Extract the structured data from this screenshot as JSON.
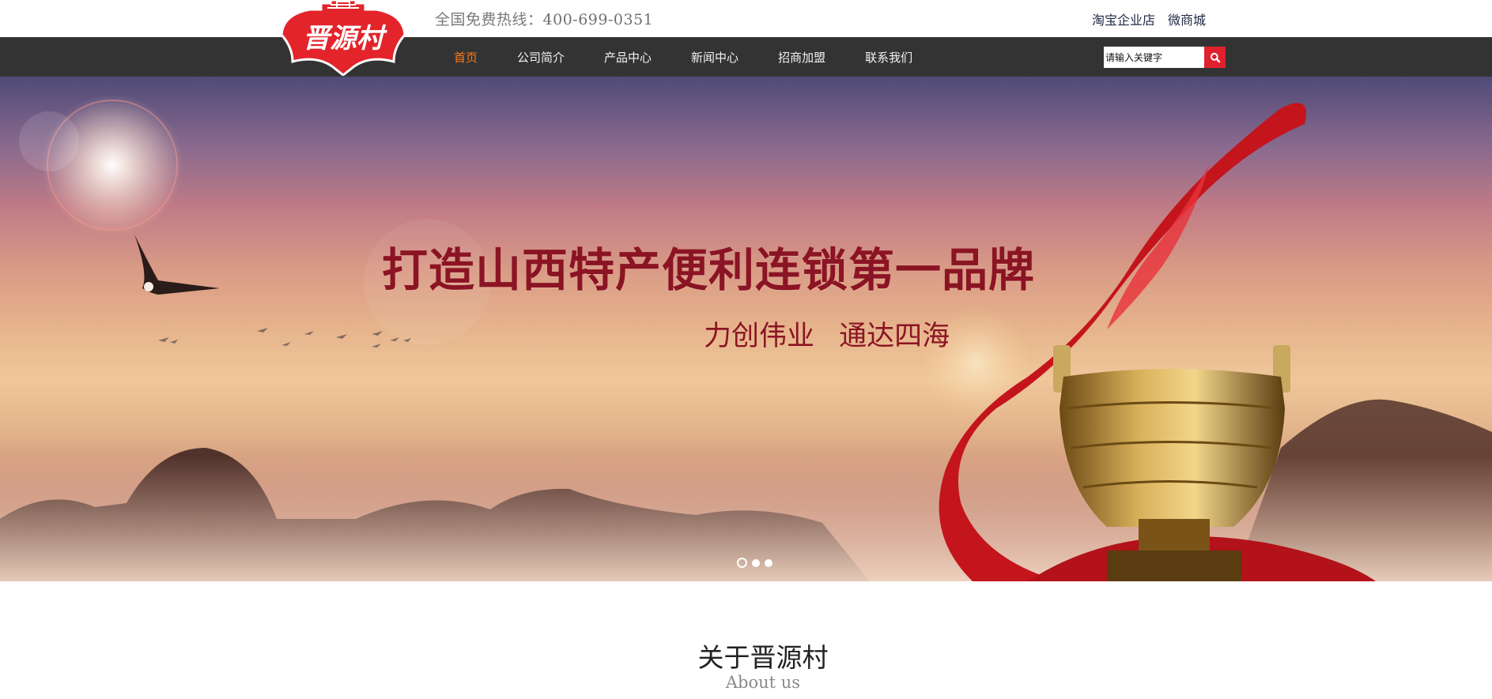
{
  "header": {
    "logo_text": "晋源村",
    "hotline_label": "全国免费热线：",
    "hotline_number": "400-699-0351",
    "links": [
      "淘宝企业店",
      "微商城"
    ]
  },
  "nav": {
    "items": [
      "首页",
      "公司简介",
      "产品中心",
      "新闻中心",
      "招商加盟",
      "联系我们"
    ],
    "active_index": 0,
    "active_color": "#ff7a18"
  },
  "search": {
    "placeholder": "请输入关键字",
    "button_icon": "search-icon",
    "button_color": "#e0202e"
  },
  "banner": {
    "title": "打造山西特产便利连锁第一品牌",
    "subtitle": "力创伟业 通达四海",
    "slides_count": 3,
    "current_slide": 1,
    "text_color": "#8b1424"
  },
  "about": {
    "title": "关于晋源村",
    "subtitle": "About us"
  }
}
